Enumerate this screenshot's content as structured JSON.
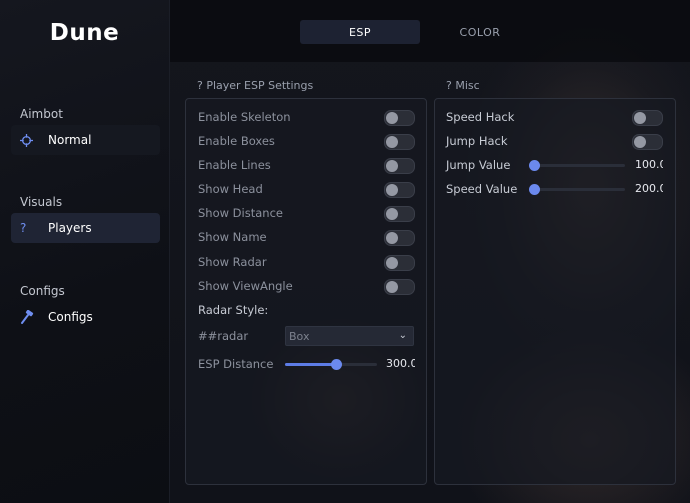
{
  "app": {
    "title": "Dune"
  },
  "sidebar": {
    "sections": [
      {
        "label": "Aimbot",
        "item": {
          "label": "Normal",
          "icon": "crosshair-icon"
        }
      },
      {
        "label": "Visuals",
        "item": {
          "label": "Players",
          "icon": "?"
        }
      },
      {
        "label": "Configs",
        "item": {
          "label": "Configs",
          "icon": "hammer-icon"
        }
      }
    ]
  },
  "tabs": [
    {
      "label": "ESP",
      "active": true
    },
    {
      "label": "COLOR",
      "active": false
    }
  ],
  "esp_panel": {
    "title": "? Player ESP Settings",
    "toggles": [
      {
        "label": "Enable Skeleton",
        "on": false
      },
      {
        "label": "Enable Boxes",
        "on": false
      },
      {
        "label": "Enable Lines",
        "on": false
      },
      {
        "label": "Show Head",
        "on": false
      },
      {
        "label": "Show Distance",
        "on": false
      },
      {
        "label": "Show Name",
        "on": false
      },
      {
        "label": "Show Radar",
        "on": false
      },
      {
        "label": "Show ViewAngle",
        "on": false
      }
    ],
    "radar_style_label": "Radar Style:",
    "radar_select_label": "##radar",
    "radar_select_value": "Box",
    "distance_label": "ESP Distance",
    "distance_value": "300.0",
    "distance_fraction": 0.55
  },
  "misc_panel": {
    "title": "? Misc",
    "toggles": [
      {
        "label": "Speed Hack",
        "on": false
      },
      {
        "label": "Jump Hack",
        "on": false
      }
    ],
    "sliders": [
      {
        "label": "Jump Value",
        "value": "100.0",
        "fraction": 0.0
      },
      {
        "label": "Speed Value",
        "value": "200.0",
        "fraction": 0.0
      }
    ]
  },
  "colors": {
    "accent": "#5d7ce6",
    "active_bg": "#1f2434"
  }
}
